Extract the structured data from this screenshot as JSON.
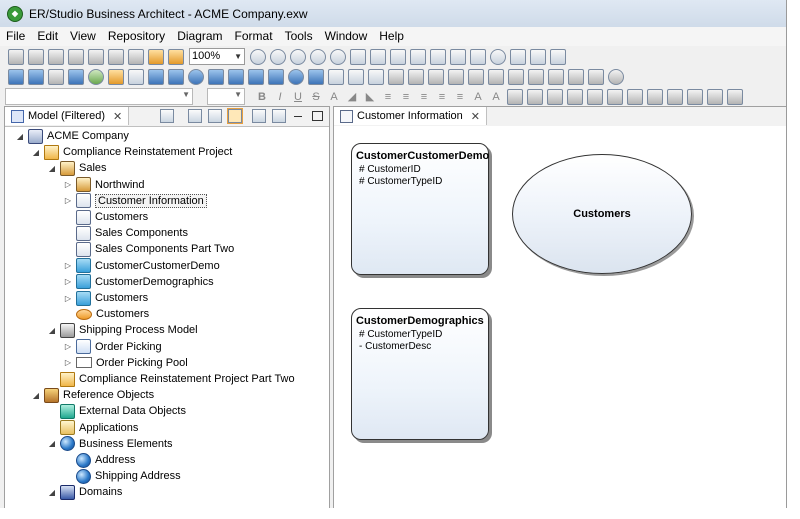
{
  "window": {
    "title": "ER/Studio Business Architect - ACME Company.exw"
  },
  "menu": [
    "File",
    "Edit",
    "View",
    "Repository",
    "Diagram",
    "Format",
    "Tools",
    "Window",
    "Help"
  ],
  "toolbar": {
    "zoom": "100%"
  },
  "left_panel": {
    "tab_label": "Model (Filtered)",
    "close_glyph": "✕",
    "tree": [
      {
        "label": "ACME Company",
        "icon": "model-icon",
        "indent": 0,
        "twisty": "◢"
      },
      {
        "label": "Compliance Reinstatement Project",
        "icon": "folder-icon",
        "indent": 1,
        "twisty": "◢"
      },
      {
        "label": "Sales",
        "icon": "people-icon",
        "indent": 2,
        "twisty": "◢"
      },
      {
        "label": "Northwind",
        "icon": "people-icon",
        "indent": 3,
        "twisty": "▷"
      },
      {
        "label": "Customer Information",
        "icon": "diagram-icon",
        "indent": 3,
        "twisty": "▷",
        "selected": true
      },
      {
        "label": "Customers",
        "icon": "diagram-icon",
        "indent": 3,
        "twisty": ""
      },
      {
        "label": "Sales Components",
        "icon": "diagram-icon",
        "indent": 3,
        "twisty": ""
      },
      {
        "label": "Sales Components Part Two",
        "icon": "diagram-icon",
        "indent": 3,
        "twisty": ""
      },
      {
        "label": "CustomerCustomerDemo",
        "icon": "entity-icon",
        "indent": 3,
        "twisty": "▷"
      },
      {
        "label": "CustomerDemographics",
        "icon": "entity-icon",
        "indent": 3,
        "twisty": "▷"
      },
      {
        "label": "Customers",
        "icon": "entity-icon",
        "indent": 3,
        "twisty": "▷"
      },
      {
        "label": "Customers",
        "icon": "ellipse-icon",
        "indent": 3,
        "twisty": ""
      },
      {
        "label": "Shipping Process Model",
        "icon": "shipping-icon",
        "indent": 2,
        "twisty": "◢"
      },
      {
        "label": "Order Picking",
        "icon": "process-icon",
        "indent": 3,
        "twisty": "▷"
      },
      {
        "label": "Order Picking Pool",
        "icon": "pool-icon",
        "indent": 3,
        "twisty": "▷"
      },
      {
        "label": "Compliance Reinstatement Project Part Two",
        "icon": "folder-icon",
        "indent": 2,
        "twisty": ""
      },
      {
        "label": "Reference Objects",
        "icon": "books-icon",
        "indent": 1,
        "twisty": "◢"
      },
      {
        "label": "External Data Objects",
        "icon": "external-data-icon",
        "indent": 2,
        "twisty": ""
      },
      {
        "label": "Applications",
        "icon": "applications-icon",
        "indent": 2,
        "twisty": ""
      },
      {
        "label": "Business Elements",
        "icon": "globe-icon",
        "indent": 2,
        "twisty": "◢"
      },
      {
        "label": "Address",
        "icon": "globe-icon",
        "indent": 3,
        "twisty": ""
      },
      {
        "label": "Shipping Address",
        "icon": "globe-icon",
        "indent": 3,
        "twisty": ""
      },
      {
        "label": "Domains",
        "icon": "domains-icon",
        "indent": 2,
        "twisty": "◢"
      }
    ]
  },
  "diagram": {
    "tab_label": "Customer Information",
    "close_glyph": "✕",
    "entities": [
      {
        "title": "CustomerCustomerDemo",
        "attrs": [
          "# CustomerID",
          "# CustomerTypeID"
        ]
      },
      {
        "title": "CustomerDemographics",
        "attrs": [
          "# CustomerTypeID",
          "- CustomerDesc"
        ]
      }
    ],
    "ellipse_label": "Customers"
  }
}
